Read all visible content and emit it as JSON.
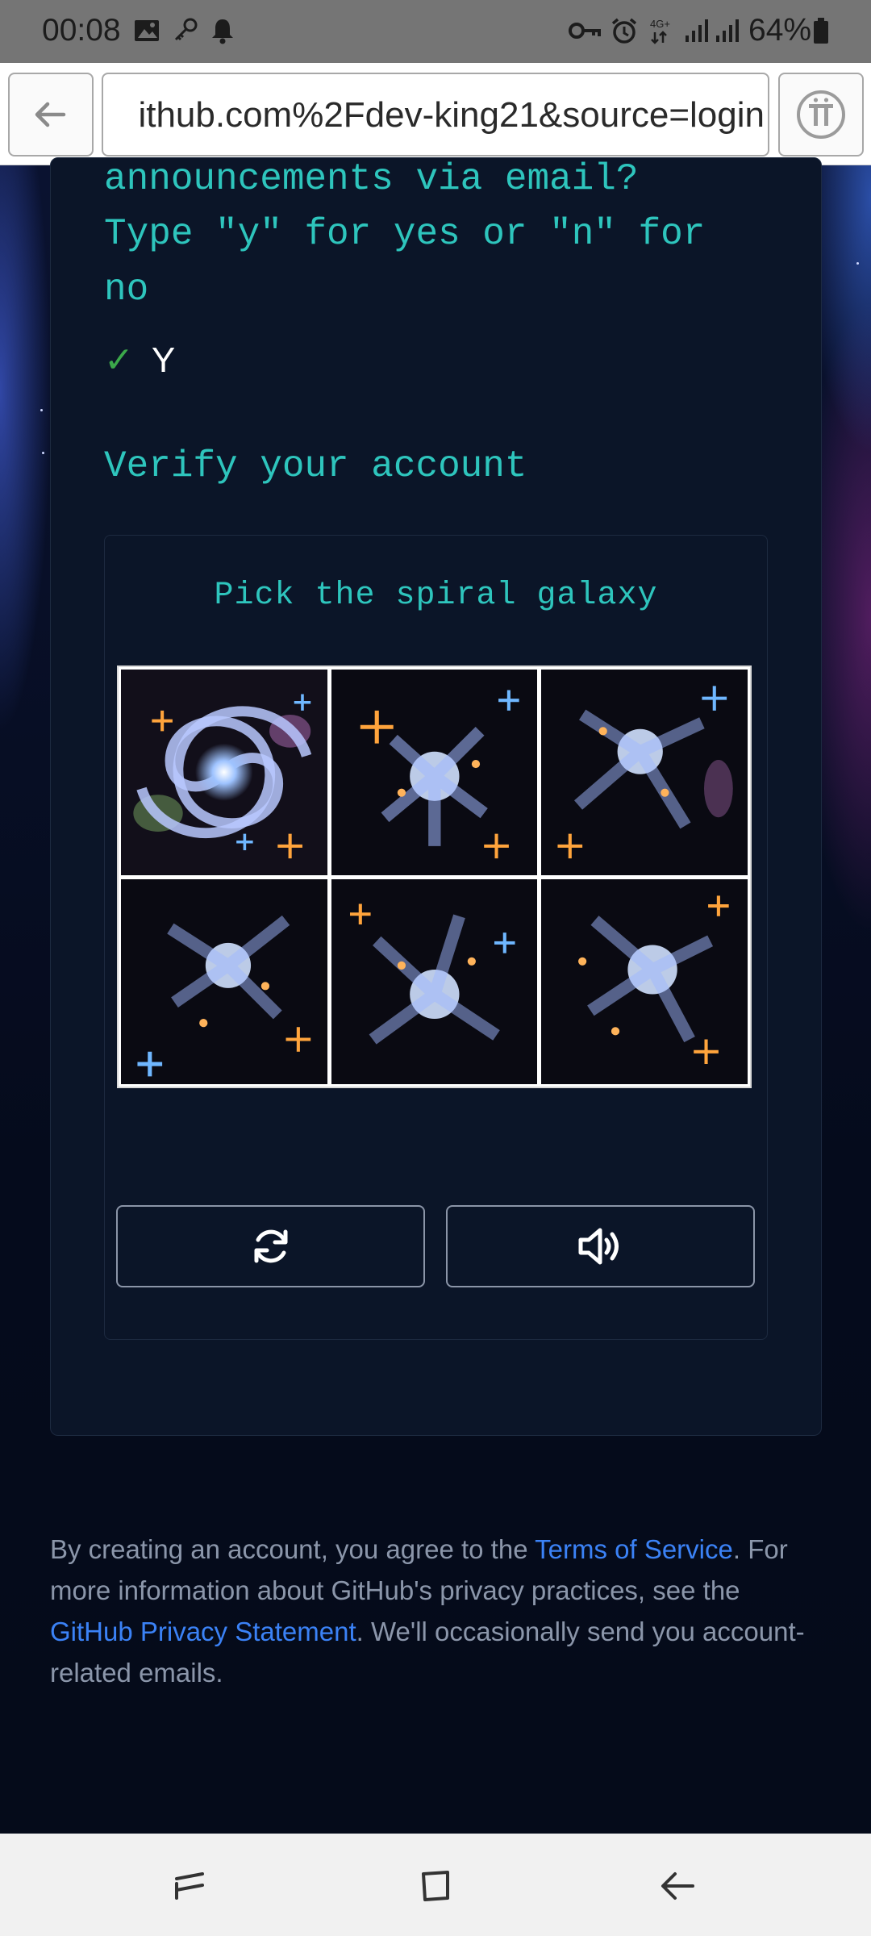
{
  "status_bar": {
    "time": "00:08",
    "battery_percent": "64%",
    "network": "4G+",
    "icons": [
      "image-icon",
      "key-icon",
      "notification-bell-icon",
      "vpn-key-icon",
      "alarm-icon",
      "signal-icon",
      "battery-icon"
    ]
  },
  "browser": {
    "url": "ithub.com%2Fdev-king21&source=login",
    "back_icon": "arrow-left-icon",
    "menu_icon": "pi-logo-icon"
  },
  "form": {
    "prompt_lines": [
      "announcements via email?",
      "Type \"y\" for yes or \"n\" for",
      "no"
    ],
    "answer_check": "✓",
    "answer_value": "Y",
    "verify_heading": "Verify your account"
  },
  "captcha": {
    "question": "Pick the spiral galaxy",
    "images": [
      {
        "label": "galaxy-option-1"
      },
      {
        "label": "galaxy-option-2"
      },
      {
        "label": "galaxy-option-3"
      },
      {
        "label": "galaxy-option-4"
      },
      {
        "label": "galaxy-option-5"
      },
      {
        "label": "galaxy-option-6"
      }
    ],
    "refresh_icon": "refresh-icon",
    "audio_icon": "speaker-icon"
  },
  "legal": {
    "part1": "By creating an account, you agree to the ",
    "terms_link": "Terms of Service",
    "part2": ". For more information about GitHub's privacy practices, see the ",
    "privacy_link": "GitHub Privacy Statement",
    "part3": ". We'll occasionally send you account-related emails."
  },
  "nav": {
    "icons": [
      "recent-apps-icon",
      "home-icon",
      "back-icon"
    ]
  },
  "colors": {
    "accent_teal": "#2ec5bd",
    "link_blue": "#3b82f6",
    "card_bg": "#0b1528",
    "page_bg": "#07101f"
  }
}
